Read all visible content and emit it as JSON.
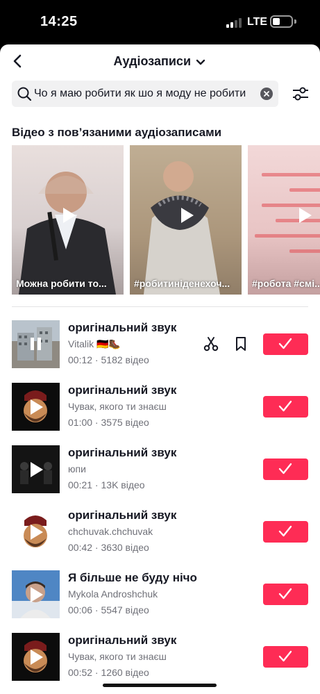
{
  "status_bar": {
    "time": "14:25",
    "network": "LTE"
  },
  "header": {
    "title": "Аудіозаписи"
  },
  "search": {
    "query": "Чо я маю робити як шо я моду не робити"
  },
  "related_videos": {
    "title": "Відео з пов’язаними аудіозаписами",
    "items": [
      {
        "caption": "Можна робити то..."
      },
      {
        "caption": "#робитиніденехоч..."
      },
      {
        "caption": "#робота #смі..."
      }
    ]
  },
  "sounds": [
    {
      "title": "оригінальний звук",
      "author": "Vitalik 🇩🇪🥾",
      "duration": "00:12",
      "videos": "5182 відео",
      "playing": true
    },
    {
      "title": "оригінальний звук",
      "author": "Чувак, якого ти знаєш",
      "duration": "01:00",
      "videos": "3575 відео",
      "playing": false
    },
    {
      "title": "оригінальний звук",
      "author": "юпи",
      "duration": "00:21",
      "videos": "13K відео",
      "playing": false
    },
    {
      "title": "оригінальний звук",
      "author": "chchuvak.chchuvak",
      "duration": "00:42",
      "videos": "3630 відео",
      "playing": false
    },
    {
      "title": "Я більше не буду нічо",
      "author": "Mykola Androshchuk",
      "duration": "00:06",
      "videos": "5547 відео",
      "playing": false
    },
    {
      "title": "оригінальний звук",
      "author": "Чувак, якого ти знаєш",
      "duration": "00:52",
      "videos": "1260 відео",
      "playing": false
    }
  ],
  "meta_sep": " · ",
  "colors": {
    "accent": "#fe2c55",
    "text_primary": "#161823",
    "text_secondary": "#6f7078"
  },
  "icons": {
    "back": "chevron-left-icon",
    "title_dropdown": "chevron-down-icon",
    "search": "search-icon",
    "clear": "clear-icon",
    "filter": "filter-sliders-icon",
    "cut": "scissors-icon",
    "bookmark": "bookmark-icon",
    "use": "checkmark-icon",
    "play": "play-icon",
    "pause": "pause-icon"
  }
}
